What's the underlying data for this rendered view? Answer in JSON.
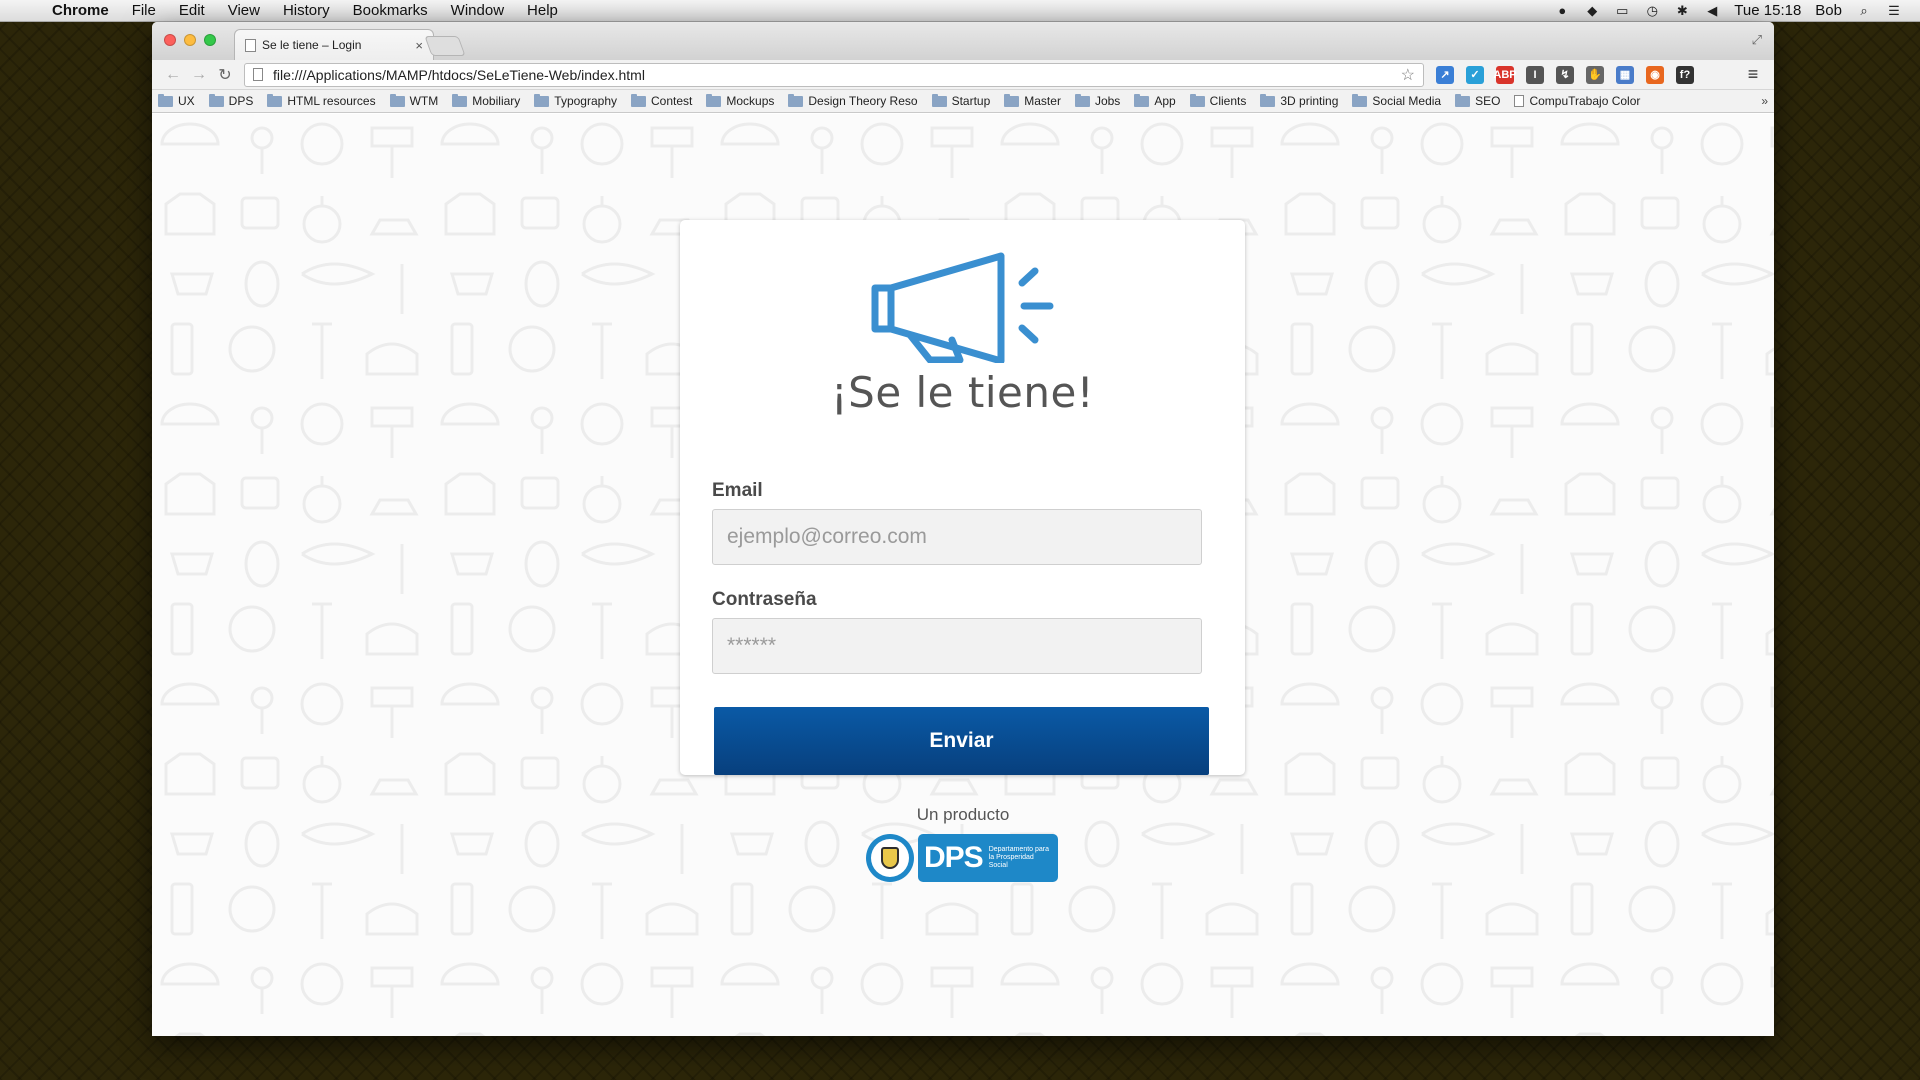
{
  "menubar": {
    "app": "Chrome",
    "items": [
      "File",
      "Edit",
      "View",
      "History",
      "Bookmarks",
      "Window",
      "Help"
    ],
    "clock": "Tue 15:18",
    "user": "Bob"
  },
  "browser": {
    "tab_title": "Se le tiene – Login",
    "tab_close": "×",
    "url": "file:///Applications/MAMP/htdocs/SeLeTiene-Web/index.html",
    "bookmarks": [
      "UX",
      "DPS",
      "HTML resources",
      "WTM",
      "Mobiliary",
      "Typography",
      "Contest",
      "Mockups",
      "Design Theory Reso",
      "Startup",
      "Master",
      "Jobs",
      "App",
      "Clients",
      "3D printing",
      "Social Media",
      "SEO"
    ],
    "bookmark_page": "CompuTrabajo Color",
    "bookmarks_more": "»",
    "extensions": [
      {
        "label": "↗",
        "color": "#3b7fd6"
      },
      {
        "label": "✓",
        "color": "#2aa0d8"
      },
      {
        "label": "ABP",
        "color": "#d9342b"
      },
      {
        "label": "I",
        "color": "#555555"
      },
      {
        "label": "↯",
        "color": "#555555"
      },
      {
        "label": "✋",
        "color": "#666666"
      },
      {
        "label": "▦",
        "color": "#4a7cc9"
      },
      {
        "label": "◉",
        "color": "#e8671f"
      },
      {
        "label": "f?",
        "color": "#333333"
      }
    ]
  },
  "login": {
    "brand": "¡Se le tiene!",
    "email_label": "Email",
    "email_placeholder": "ejemplo@correo.com",
    "password_label": "Contraseña",
    "password_placeholder": "******",
    "submit_label": "Enviar",
    "product_by": "Un producto",
    "dps_short": "DPS",
    "dps_name": "Departamento para la Prosperidad Social"
  },
  "colors": {
    "accent": "#3a8fd0",
    "button": "#073f7d",
    "dps_blue": "#1e88c8"
  }
}
